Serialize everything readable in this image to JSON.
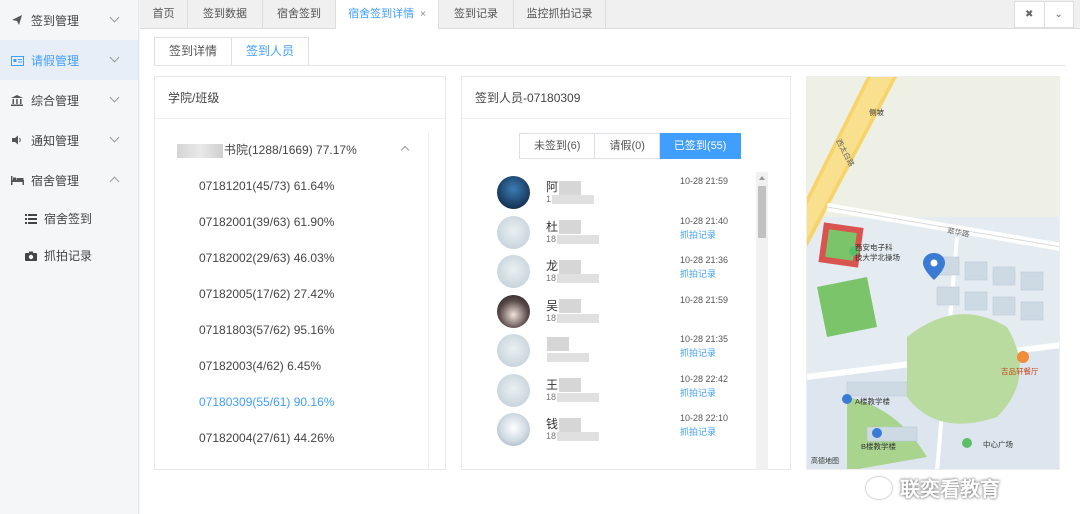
{
  "sidebar": {
    "items": [
      {
        "label": "签到管理",
        "icon": "paper-plane-icon"
      },
      {
        "label": "请假管理",
        "icon": "id-card-icon"
      },
      {
        "label": "综合管理",
        "icon": "bank-icon"
      },
      {
        "label": "通知管理",
        "icon": "speaker-icon"
      },
      {
        "label": "宿舍管理",
        "icon": "bed-icon"
      }
    ],
    "subitems": [
      {
        "label": "宿舍签到",
        "icon": "list-icon"
      },
      {
        "label": "抓拍记录",
        "icon": "camera-icon"
      }
    ]
  },
  "tabs": [
    {
      "label": "首页"
    },
    {
      "label": "签到数据"
    },
    {
      "label": "宿舍签到"
    },
    {
      "label": "宿舍签到详情",
      "close": "×"
    },
    {
      "label": "签到记录"
    },
    {
      "label": "监控抓拍记录"
    }
  ],
  "subtabs": [
    {
      "label": "签到详情"
    },
    {
      "label": "签到人员"
    }
  ],
  "college_panel": {
    "title": "学院/班级",
    "college": {
      "name_suffix": "书院(1288/1669) 77.17%"
    },
    "classes": [
      "07181201(45/73) 61.64%",
      "07182001(39/63) 61.90%",
      "07182002(29/63) 46.03%",
      "07182005(17/62) 27.42%",
      "07181803(57/62) 95.16%",
      "07182003(4/62) 6.45%",
      "07180309(55/61) 90.16%",
      "07182004(27/61) 44.26%"
    ]
  },
  "person_panel": {
    "title": "签到人员-07180309",
    "filters": [
      "未签到(6)",
      "请假(0)",
      "已签到(55)"
    ],
    "people": [
      {
        "surname": "阿",
        "id_prefix": "1",
        "time": "10-28 21:59",
        "link": ""
      },
      {
        "surname": "杜",
        "id_prefix": "18",
        "time": "10-28 21:40",
        "link": "抓拍记录"
      },
      {
        "surname": "龙",
        "id_prefix": "18",
        "time": "10-28 21:36",
        "link": "抓拍记录"
      },
      {
        "surname": "吴",
        "id_prefix": "18",
        "time": "10-28 21:59",
        "link": ""
      },
      {
        "surname": "",
        "id_prefix": "",
        "time": "10-28 21:35",
        "link": "抓拍记录"
      },
      {
        "surname": "王",
        "id_prefix": "18",
        "time": "10-28 22:42",
        "link": "抓拍记录"
      },
      {
        "surname": "钱",
        "id_prefix": "18",
        "time": "10-28 22:10",
        "link": "抓拍记录"
      }
    ]
  },
  "map": {
    "labels": {
      "school": "西安电子科\n技大学北操场",
      "building_a": "A楼教学楼",
      "building_b": "B楼教学楼",
      "plaza": "中心广场",
      "restaurant": "吉品轩餐厅",
      "road1": "西太白路",
      "road2": "翠华路",
      "pin": "侧坡",
      "logo": "高德地图"
    }
  },
  "watermark": "联奕看教育",
  "colors": {
    "accent": "#409eff"
  }
}
